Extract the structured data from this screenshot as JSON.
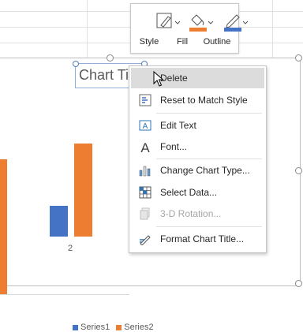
{
  "mini_toolbar": {
    "style_label": "Style",
    "fill_label": "Fill",
    "outline_label": "Outline",
    "fill_color": "#ed7d31",
    "outline_color": "#4472c4"
  },
  "chart": {
    "title": "Chart Title",
    "x_tick": "2",
    "legend": [
      {
        "name": "Series1",
        "color": "#4472c4"
      },
      {
        "name": "Series2",
        "color": "#ed7d31"
      }
    ]
  },
  "context_menu": {
    "items": [
      {
        "label": "Delete",
        "icon": "delete-icon",
        "state": "hovered"
      },
      {
        "label": "Reset to Match Style",
        "icon": "reset-style-icon"
      },
      {
        "label": "Edit Text",
        "icon": "edit-text-icon"
      },
      {
        "label": "Font...",
        "icon": "font-icon"
      },
      {
        "label": "Change Chart Type...",
        "icon": "chart-type-icon"
      },
      {
        "label": "Select Data...",
        "icon": "select-data-icon"
      },
      {
        "label": "3-D Rotation...",
        "icon": "rotation-icon",
        "state": "disabled"
      },
      {
        "label": "Format Chart Title...",
        "icon": "format-icon"
      }
    ]
  }
}
